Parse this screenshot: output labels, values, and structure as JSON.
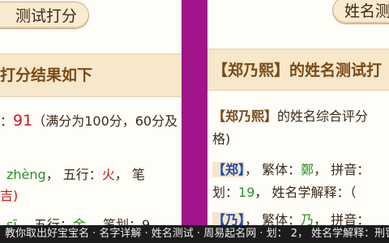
{
  "left": {
    "button_label": "测试打分",
    "header": "打分结果如下",
    "score_prefix": "：",
    "score": "91",
    "score_note": "（满分为100分，60分及",
    "row1_pinyin": "zhèng",
    "row1_wuxing_label": "，  五行：",
    "row1_wuxing": "火",
    "row1_tail": "，  笔",
    "row2_text": "吉)",
    "row3_pinyin": "sī",
    "row3_wuxing_label": "，  五行：",
    "row3_wuxing": "金",
    "row3_tail": "，  笔划：9，"
  },
  "right": {
    "button_label": "姓名测",
    "header": "【郑乃熙】的姓名测试打",
    "line1_name": "【郑乃熙】",
    "line1_text": "的姓名综合评分",
    "line2_text": "格)",
    "c1_char": "【郑】",
    "c1_mid": "，  繁体：",
    "c1_trad": "鄭",
    "c1_tail": "，  拼音：",
    "c1_stroke_label": "划：",
    "c1_stroke": "19",
    "c1_meaning": "，  姓名学解释：（",
    "c2_char": "【乃】",
    "c2_mid": "，  繁体：",
    "c2_trad": "乃",
    "c2_tail": "，  拼音："
  },
  "footer": {
    "text": "教你取出好宝宝名 · 名字详解 · 姓名测试 · 周易起名网 · 划： 2， 姓名学解释：刑罚"
  }
}
